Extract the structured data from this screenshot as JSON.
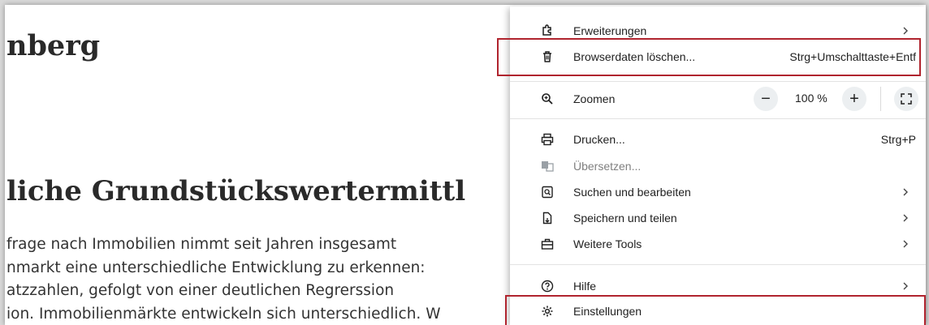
{
  "webpage": {
    "title_fragment": "nberg",
    "heading_fragment": "liche Grundstückswertermittl",
    "paragraph_lines": [
      "frage nach Immobilien nimmt seit Jahren insgesamt",
      "nmarkt eine unterschiedliche Entwicklung zu erkennen:",
      "atzzahlen, gefolgt von einer deutlichen Regrerssion",
      "ion. Immobilienmärkte entwickeln sich  unterschiedlich. W"
    ]
  },
  "menu": {
    "items": [
      {
        "id": "extensions",
        "label": "Erweiterungen",
        "icon": "puzzle-icon",
        "submenu": true
      },
      {
        "id": "clear-data",
        "label": "Browserdaten löschen...",
        "icon": "trash-icon",
        "shortcut": "Strg+Umschalttaste+Entf",
        "highlighted": true
      },
      {
        "id": "zoom",
        "label": "Zoomen",
        "icon": "zoom-icon"
      },
      {
        "id": "print",
        "label": "Drucken...",
        "icon": "printer-icon",
        "shortcut": "Strg+P"
      },
      {
        "id": "translate",
        "label": "Übersetzen...",
        "icon": "translate-icon",
        "disabled": true
      },
      {
        "id": "find-edit",
        "label": "Suchen und bearbeiten",
        "icon": "find-icon",
        "submenu": true
      },
      {
        "id": "save-share",
        "label": "Speichern und teilen",
        "icon": "save-share-icon",
        "submenu": true
      },
      {
        "id": "more-tools",
        "label": "Weitere Tools",
        "icon": "toolbox-icon",
        "submenu": true
      },
      {
        "id": "help",
        "label": "Hilfe",
        "icon": "help-icon",
        "submenu": true
      },
      {
        "id": "settings",
        "label": "Einstellungen",
        "icon": "gear-icon",
        "highlighted": true
      }
    ],
    "zoom": {
      "minus": "−",
      "value": "100 %",
      "plus": "+"
    }
  },
  "colors": {
    "highlight": "#b0242e",
    "separator": "#e3e3e3",
    "button_bg": "#eceff1"
  }
}
